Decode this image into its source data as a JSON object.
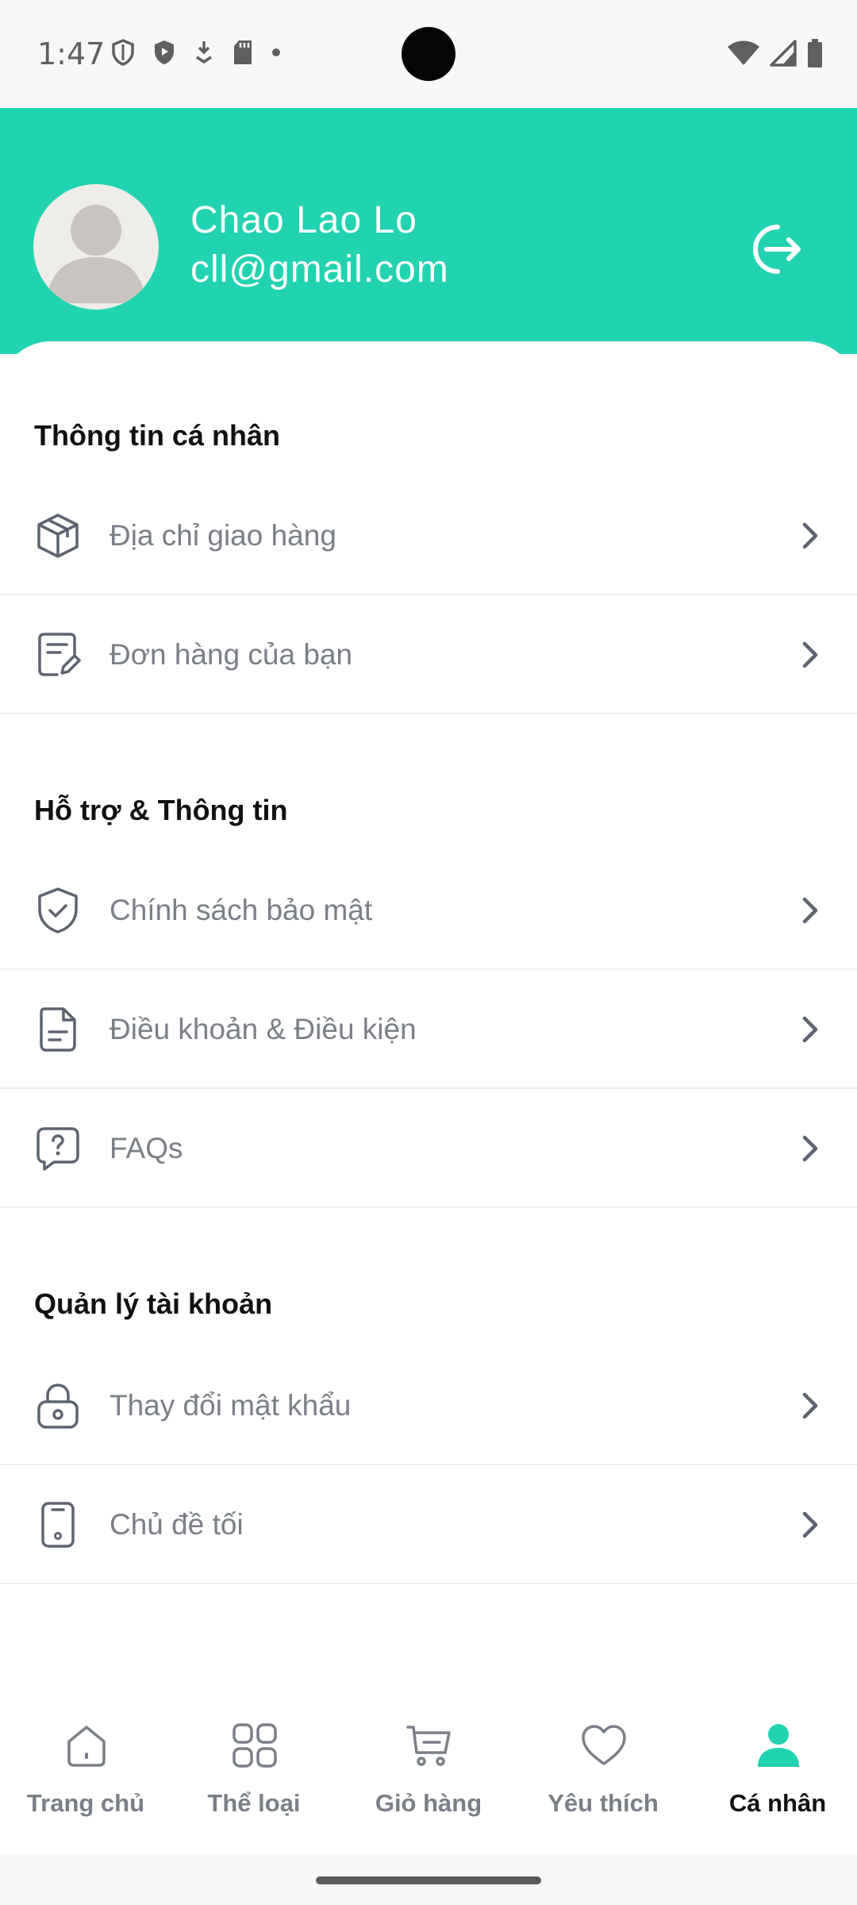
{
  "status_bar": {
    "time": "1:47",
    "left_icons": [
      "shield-icon",
      "play-shield-icon",
      "download-icon",
      "sd-card-icon",
      "dot-icon"
    ],
    "right_icons": [
      "wifi-icon",
      "signal-icon",
      "battery-icon"
    ]
  },
  "header": {
    "name": "Chao Lao Lo",
    "email": "cll@gmail.com",
    "background_color": "#22d3b2",
    "logout_icon": "logout-icon"
  },
  "sections": [
    {
      "title": "Thông tin cá nhân",
      "items": [
        {
          "label": "Địa chỉ giao hàng",
          "icon": "package-icon"
        },
        {
          "label": "Đơn hàng của bạn",
          "icon": "receipt-edit-icon"
        }
      ]
    },
    {
      "title": "Hỗ trợ & Thông tin",
      "items": [
        {
          "label": "Chính sách bảo mật",
          "icon": "shield-check-icon"
        },
        {
          "label": "Điều khoản & Điều kiện",
          "icon": "document-icon"
        },
        {
          "label": "FAQs",
          "icon": "question-bubble-icon"
        }
      ]
    },
    {
      "title": "Quản lý tài khoản",
      "items": [
        {
          "label": "Thay đổi mật khẩu",
          "icon": "lock-icon"
        },
        {
          "label": "Chủ đề tối",
          "icon": "phone-icon"
        }
      ]
    }
  ],
  "bottom_nav": [
    {
      "label": "Trang chủ",
      "icon": "home-icon",
      "active": false
    },
    {
      "label": "Thể loại",
      "icon": "grid-icon",
      "active": false
    },
    {
      "label": "Giỏ hàng",
      "icon": "cart-icon",
      "active": false
    },
    {
      "label": "Yêu thích",
      "icon": "heart-icon",
      "active": false
    },
    {
      "label": "Cá nhân",
      "icon": "person-icon",
      "active": true
    }
  ],
  "colors": {
    "accent": "#22d3b2",
    "label_gray": "#7a7f87",
    "title": "#111111"
  }
}
